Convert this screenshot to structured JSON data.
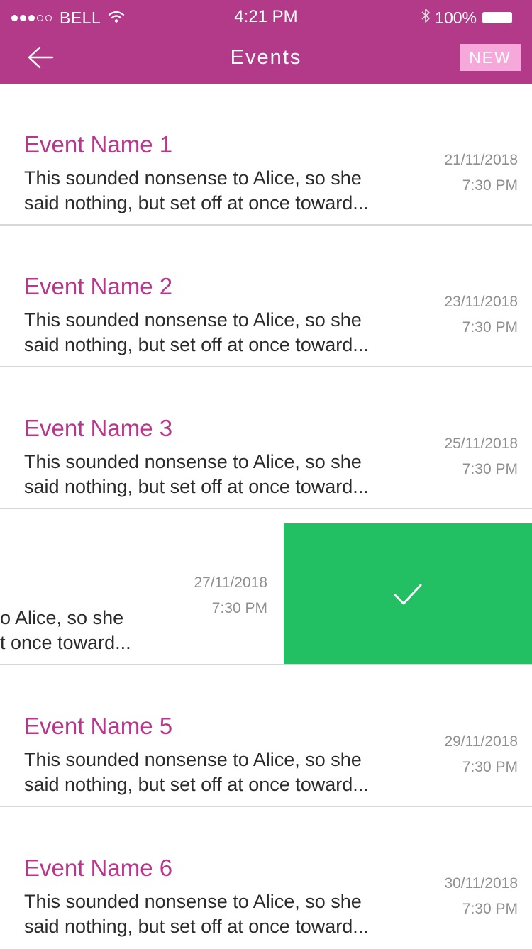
{
  "status_bar": {
    "carrier": "BELL",
    "time": "4:21 PM",
    "battery": "100%"
  },
  "nav": {
    "title": "Events",
    "new_label": "NEW"
  },
  "events": [
    {
      "name": "Event Name 1",
      "desc_line1": "This sounded nonsense to Alice, so she",
      "desc_line2": "said nothing, but set off at once toward...",
      "date": "21/11/2018",
      "time": "7:30 PM"
    },
    {
      "name": "Event Name 2",
      "desc_line1": "This sounded nonsense to Alice, so she",
      "desc_line2": "said nothing, but set off at once toward...",
      "date": "23/11/2018",
      "time": "7:30 PM"
    },
    {
      "name": "Event Name 3",
      "desc_line1": "This sounded nonsense to Alice, so she",
      "desc_line2": "said nothing, but set off at once toward...",
      "date": "25/11/2018",
      "time": "7:30 PM"
    },
    {
      "name": "",
      "desc_line1": "o Alice, so she",
      "desc_line2": "t once toward...",
      "date": "27/11/2018",
      "time": "7:30 PM"
    },
    {
      "name": "Event Name 5",
      "desc_line1": "This sounded nonsense to Alice, so she",
      "desc_line2": "said nothing, but set off at once toward...",
      "date": "29/11/2018",
      "time": "7:30 PM"
    },
    {
      "name": "Event Name 6",
      "desc_line1": "This sounded nonsense to Alice, so she",
      "desc_line2": "said nothing, but set off at once toward...",
      "date": "30/11/2018",
      "time": "7:30 PM"
    }
  ],
  "colors": {
    "header": "#b23a89",
    "new_button": "#f7a8db",
    "event_name": "#b8378b",
    "swipe_action": "#22bf63"
  },
  "icons": {
    "back": "arrow-left-icon",
    "swipe": "checkmark-icon",
    "wifi": "wifi-icon",
    "bluetooth": "bluetooth-icon"
  }
}
